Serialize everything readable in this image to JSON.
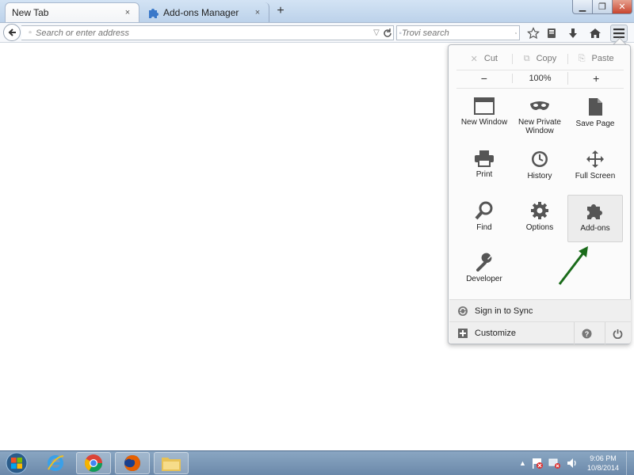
{
  "tabs": [
    {
      "label": "New Tab",
      "close": "×"
    },
    {
      "label": "Add-ons Manager",
      "close": "×"
    }
  ],
  "new_tab_symbol": "+",
  "window_controls": {
    "minimize": "▁",
    "maximize": "❐",
    "close": "✕"
  },
  "nav": {
    "url_placeholder": "Search or enter address",
    "search_placeholder": "Trovi search"
  },
  "panel": {
    "edit": {
      "cut": "Cut",
      "copy": "Copy",
      "paste": "Paste"
    },
    "zoom": {
      "minus": "−",
      "level": "100%",
      "plus": "+"
    },
    "items": [
      {
        "label": "New Window",
        "icon": "new-window-icon"
      },
      {
        "label": "New Private Window",
        "icon": "private-window-icon"
      },
      {
        "label": "Save Page",
        "icon": "save-page-icon"
      },
      {
        "label": "Print",
        "icon": "print-icon"
      },
      {
        "label": "History",
        "icon": "history-icon"
      },
      {
        "label": "Full Screen",
        "icon": "full-screen-icon"
      },
      {
        "label": "Find",
        "icon": "find-icon"
      },
      {
        "label": "Options",
        "icon": "options-icon"
      },
      {
        "label": "Add-ons",
        "icon": "add-ons-icon"
      },
      {
        "label": "Developer",
        "icon": "developer-icon"
      }
    ],
    "sync_label": "Sign in to Sync",
    "customize_label": "Customize"
  },
  "taskbar": {
    "clock_time": "9:06 PM",
    "clock_date": "10/8/2014"
  },
  "colors": {
    "annotation_arrow": "#1a6b1a",
    "taskbar": "#6b89aa",
    "panel_bg": "#fbfbfb"
  }
}
